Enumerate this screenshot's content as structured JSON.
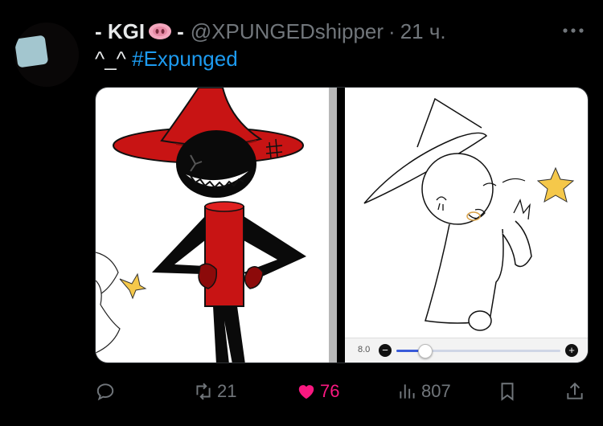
{
  "tweet": {
    "display_name": "- KGI",
    "name_suffix": "-",
    "handle": "@XPUNGEDshipper",
    "separator": "·",
    "time": "21 ч.",
    "text": "^_^",
    "hashtag": "#Expunged"
  },
  "media": {
    "left_image": "illustration-red-hat-character",
    "right_image": "sketch-witch-hat-character",
    "slider": {
      "value_label": "8.0",
      "minus_label": "−",
      "plus_label": "+",
      "level": 0.17
    }
  },
  "actions": {
    "reply_icon": "reply-icon",
    "retweet_count": "21",
    "like_count": "76",
    "views_count": "807",
    "bookmark_icon": "bookmark-icon",
    "share_icon": "share-icon"
  },
  "colors": {
    "accent_link": "#1d9bf0",
    "like": "#f91880",
    "muted": "#71767b",
    "background": "#000000"
  }
}
